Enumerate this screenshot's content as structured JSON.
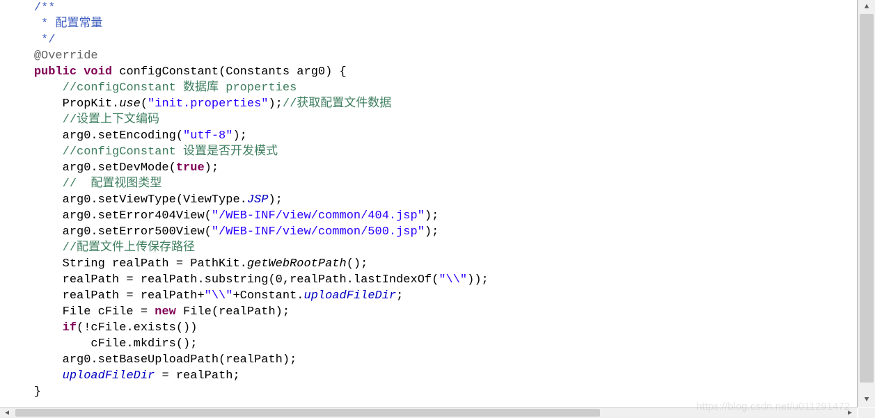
{
  "lines": [
    [
      {
        "cls": "c-pln",
        "t": "    "
      },
      {
        "cls": "c-jd",
        "t": "/**"
      }
    ],
    [
      {
        "cls": "c-pln",
        "t": "     "
      },
      {
        "cls": "c-jd",
        "t": "* 配置常量"
      }
    ],
    [
      {
        "cls": "c-pln",
        "t": "     "
      },
      {
        "cls": "c-jd",
        "t": "*/"
      }
    ],
    [
      {
        "cls": "c-pln",
        "t": "    "
      },
      {
        "cls": "c-ann",
        "t": "@Override"
      }
    ],
    [
      {
        "cls": "c-pln",
        "t": "    "
      },
      {
        "cls": "c-kw",
        "t": "public"
      },
      {
        "cls": "c-pln",
        "t": " "
      },
      {
        "cls": "c-kw",
        "t": "void"
      },
      {
        "cls": "c-pln",
        "t": " configConstant(Constants arg0) {"
      }
    ],
    [
      {
        "cls": "c-pln",
        "t": "        "
      },
      {
        "cls": "c-sc",
        "t": "//configConstant 数据库 properties"
      }
    ],
    [
      {
        "cls": "c-pln",
        "t": "        PropKit."
      },
      {
        "cls": "c-sti",
        "t": "use"
      },
      {
        "cls": "c-pln",
        "t": "("
      },
      {
        "cls": "c-str",
        "t": "\"init.properties\""
      },
      {
        "cls": "c-pln",
        "t": ");"
      },
      {
        "cls": "c-sc",
        "t": "//获取配置文件数据"
      }
    ],
    [
      {
        "cls": "c-pln",
        "t": "        "
      },
      {
        "cls": "c-sc",
        "t": "//设置上下文编码"
      }
    ],
    [
      {
        "cls": "c-pln",
        "t": "        arg0.setEncoding("
      },
      {
        "cls": "c-str",
        "t": "\"utf-8\""
      },
      {
        "cls": "c-pln",
        "t": ");"
      }
    ],
    [
      {
        "cls": "c-pln",
        "t": "        "
      },
      {
        "cls": "c-sc",
        "t": "//configConstant 设置是否开发模式"
      }
    ],
    [
      {
        "cls": "c-pln",
        "t": "        arg0.setDevMode("
      },
      {
        "cls": "c-kw",
        "t": "true"
      },
      {
        "cls": "c-pln",
        "t": ");"
      }
    ],
    [
      {
        "cls": "c-pln",
        "t": "        "
      },
      {
        "cls": "c-sc",
        "t": "//  配置视图类型"
      }
    ],
    [
      {
        "cls": "c-pln",
        "t": "        arg0.setViewType(ViewType."
      },
      {
        "cls": "c-stc",
        "t": "JSP"
      },
      {
        "cls": "c-pln",
        "t": ");"
      }
    ],
    [
      {
        "cls": "c-pln",
        "t": "        arg0.setError404View("
      },
      {
        "cls": "c-str",
        "t": "\"/WEB-INF/view/common/404.jsp\""
      },
      {
        "cls": "c-pln",
        "t": ");"
      }
    ],
    [
      {
        "cls": "c-pln",
        "t": "        arg0.setError500View("
      },
      {
        "cls": "c-str",
        "t": "\"/WEB-INF/view/common/500.jsp\""
      },
      {
        "cls": "c-pln",
        "t": ");"
      }
    ],
    [
      {
        "cls": "c-pln",
        "t": "        "
      },
      {
        "cls": "c-sc",
        "t": "//配置文件上传保存路径"
      }
    ],
    [
      {
        "cls": "c-pln",
        "t": "        String realPath = PathKit."
      },
      {
        "cls": "c-sti",
        "t": "getWebRootPath"
      },
      {
        "cls": "c-pln",
        "t": "();"
      }
    ],
    [
      {
        "cls": "c-pln",
        "t": "        realPath = realPath.substring(0,realPath.lastIndexOf("
      },
      {
        "cls": "c-str",
        "t": "\"\\\\\""
      },
      {
        "cls": "c-pln",
        "t": "));"
      }
    ],
    [
      {
        "cls": "c-pln",
        "t": "        realPath = realPath+"
      },
      {
        "cls": "c-str",
        "t": "\"\\\\\""
      },
      {
        "cls": "c-pln",
        "t": "+Constant."
      },
      {
        "cls": "c-stc",
        "t": "uploadFileDir"
      },
      {
        "cls": "c-pln",
        "t": ";"
      }
    ],
    [
      {
        "cls": "c-pln",
        "t": "        File cFile = "
      },
      {
        "cls": "c-kw",
        "t": "new"
      },
      {
        "cls": "c-pln",
        "t": " File(realPath);"
      }
    ],
    [
      {
        "cls": "c-pln",
        "t": "        "
      },
      {
        "cls": "c-kw",
        "t": "if"
      },
      {
        "cls": "c-pln",
        "t": "(!cFile.exists())"
      }
    ],
    [
      {
        "cls": "c-pln",
        "t": "            cFile.mkdirs();"
      }
    ],
    [
      {
        "cls": "c-pln",
        "t": "        arg0.setBaseUploadPath(realPath);"
      }
    ],
    [
      {
        "cls": "c-pln",
        "t": "        "
      },
      {
        "cls": "c-stc",
        "t": "uploadFileDir"
      },
      {
        "cls": "c-pln",
        "t": " = realPath;"
      }
    ],
    [
      {
        "cls": "c-pln",
        "t": "    }"
      }
    ]
  ],
  "watermark": "https://blog.csdn.net/u011291472",
  "scroll": {
    "up_glyph": "▲",
    "down_glyph": "▼",
    "left_glyph": "◀",
    "right_glyph": "▶"
  }
}
